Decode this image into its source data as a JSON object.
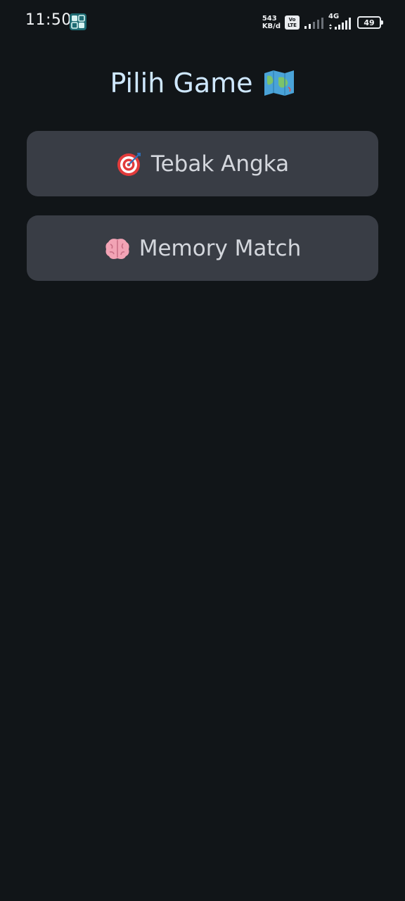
{
  "status_bar": {
    "time": "11:50",
    "net_speed_value": "543",
    "net_speed_unit": "KB/d",
    "volte_top": "Vo",
    "volte_bottom": "LTE",
    "network_type": "4G",
    "battery_level": "49"
  },
  "page": {
    "title": "Pilih Game",
    "title_icon": "map-icon"
  },
  "games": [
    {
      "label": "Tebak Angka",
      "icon": "target-icon"
    },
    {
      "label": "Memory Match",
      "icon": "brain-icon"
    }
  ],
  "colors": {
    "background": "#111518",
    "title": "#cfe8ff",
    "button_bg": "#393d45",
    "button_text": "#d4d7dd"
  }
}
